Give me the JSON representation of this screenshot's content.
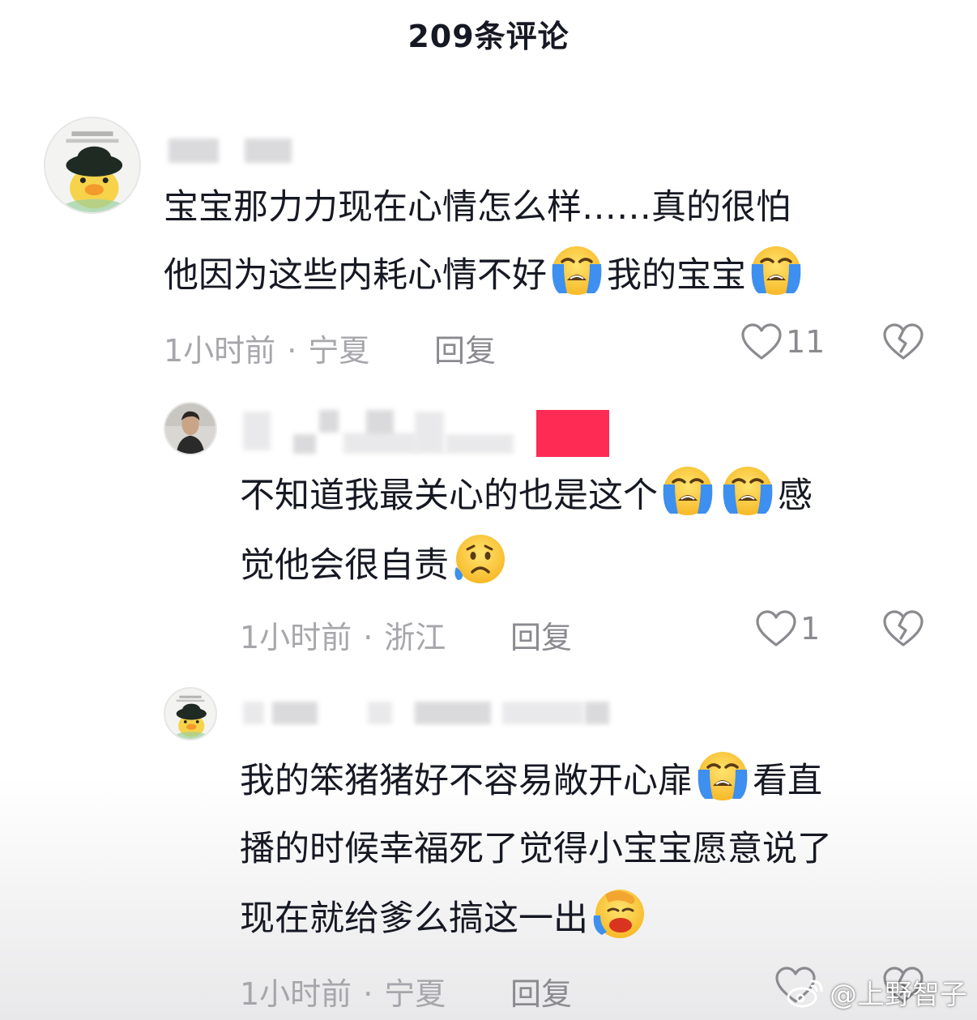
{
  "header": {
    "title": "209条评论"
  },
  "comments": [
    {
      "text_line1": "宝宝那力力现在心情怎么样……真的很怕",
      "text_line2a": "他因为这些内耗心情不好",
      "text_line2b": "我的宝宝",
      "time": "1小时前",
      "dot": "·",
      "location": "宁夏",
      "reply": "回复",
      "likes": "11"
    },
    {
      "text_line1a": "不知道我最关心的也是这个",
      "text_line1b": "感",
      "text_line2": "觉他会很自责",
      "time": "1小时前",
      "dot": "·",
      "location": "浙江",
      "reply": "回复",
      "likes": "1"
    },
    {
      "text_line1a": "我的笨猪猪好不容易敞开心扉",
      "text_line1b": "看直",
      "text_line2": "播的时候幸福死了觉得小宝宝愿意说了",
      "text_line3": "现在就给爹么搞这一出",
      "time": "1小时前",
      "dot": "·",
      "location": "宁夏",
      "reply": "回复",
      "likes": ""
    }
  ],
  "watermark": {
    "text": "@上野智子",
    "icon": "weibo-icon"
  },
  "icons": {
    "like": "heart-outline-icon",
    "dislike": "broken-heart-icon",
    "crying": "loudly-crying-face-emoji",
    "sad": "sad-but-relieved-face-emoji",
    "sobbing": "face-holding-back-tears-emoji"
  },
  "colors": {
    "accent": "#fe2c55",
    "meta": "#a6a6ab",
    "text": "#161823"
  }
}
